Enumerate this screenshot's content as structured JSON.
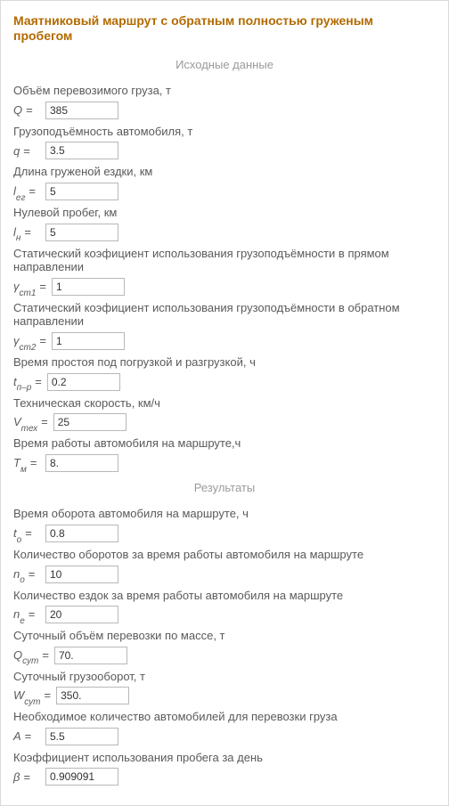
{
  "title": "Маятниковый маршрут с обратным полностью груженым пробегом",
  "sections": {
    "input": "Исходные данные",
    "output": "Результаты"
  },
  "input": {
    "Q": {
      "label": "Объём перевозимого груза, т",
      "value": "385"
    },
    "q": {
      "label": "Грузоподъёмность автомобиля, т",
      "value": "3.5"
    },
    "l_eg": {
      "label": "Длина груженой ездки, км",
      "value": "5"
    },
    "l_n": {
      "label": "Нулевой пробег, км",
      "value": "5"
    },
    "gamma1": {
      "label": "Статический коэфициент использования грузоподъёмности в прямом направлении",
      "value": "1"
    },
    "gamma2": {
      "label": "Статический коэфициент использования грузоподъёмности в обратном направлении",
      "value": "1"
    },
    "t_pr": {
      "label": "Время простоя под погрузкой и разгрузкой, ч",
      "value": "0.2"
    },
    "V_tex": {
      "label": "Техническая скорость, км/ч",
      "value": "25"
    },
    "T_m": {
      "label": "Время работы автомобиля на маршруте,ч",
      "value": "8."
    }
  },
  "output": {
    "t_o": {
      "label": "Время оборота автомобиля на маршруте, ч",
      "value": "0.8"
    },
    "n_o": {
      "label": "Количество оборотов за время работы автомобиля на маршруте",
      "value": "10"
    },
    "n_e": {
      "label": "Количество ездок за время работы автомобиля на маршруте",
      "value": "20"
    },
    "Q_sut": {
      "label": "Суточный объём перевозки по массе, т",
      "value": "70."
    },
    "W_sut": {
      "label": "Суточный грузооборот, т",
      "value": "350."
    },
    "A": {
      "label": "Необходимое количество автомобилей для перевозки груза",
      "value": "5.5"
    },
    "beta": {
      "label": "Коэффициент использования пробега за день",
      "value": "0.909091"
    }
  }
}
